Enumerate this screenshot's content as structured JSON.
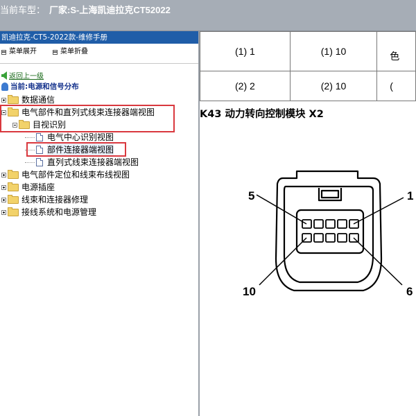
{
  "titlebar": {
    "label": "当前车型：",
    "vehicle": "厂家:S-上海凯迪拉克CT52022"
  },
  "left_panel": {
    "header": "凯迪拉克-CT5-2022款-维修手册",
    "expand_menu": "菜单展开",
    "collapse_menu": "菜单折叠",
    "back_link": "返回上一级",
    "current": "当前:电源和信号分布",
    "tree": [
      {
        "label": "数据通信"
      },
      {
        "label": "电气部件和直列式线束连接器端视图"
      },
      {
        "label": "目视识别"
      },
      {
        "label": "电气中心识别视图"
      },
      {
        "label": "部件连接器端视图"
      },
      {
        "label": "直列式线束连接器端视图"
      },
      {
        "label": "电气部件定位和线束布线视图"
      },
      {
        "label": "电源插座"
      },
      {
        "label": "线束和连接器修理"
      },
      {
        "label": "接线系统和电源管理"
      }
    ]
  },
  "right_panel": {
    "table_rows": [
      [
        "(1) 1",
        "(1) 10",
        "色"
      ],
      [
        "(2) 2",
        "(2) 10",
        "("
      ]
    ],
    "connector_title": "K43 动力转向控制模块 X2",
    "pin_labels": {
      "tl": "5",
      "tr": "1",
      "bl": "10",
      "br": "6"
    }
  },
  "colors": {
    "titlebar_bg": "#a6adb6",
    "panel_header_bg": "#1f5da8",
    "highlight_border": "#d9383e",
    "current_text": "#14328c"
  }
}
